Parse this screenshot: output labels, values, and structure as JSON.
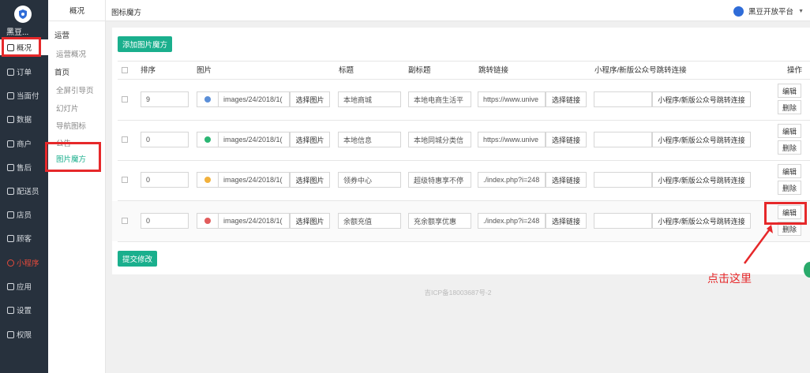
{
  "nav": {
    "brand": "黑豆...",
    "items": [
      {
        "label": "概况",
        "icon": "dashboard-icon"
      },
      {
        "label": "订单",
        "icon": "order-icon"
      },
      {
        "label": "当面付",
        "icon": "pay-icon"
      },
      {
        "label": "数据",
        "icon": "data-icon"
      },
      {
        "label": "商户",
        "icon": "merchant-icon"
      },
      {
        "label": "售后",
        "icon": "after-sale-icon"
      },
      {
        "label": "配送员",
        "icon": "courier-icon"
      },
      {
        "label": "店员",
        "icon": "clerk-icon"
      },
      {
        "label": "顾客",
        "icon": "customer-icon"
      },
      {
        "label": "小程序",
        "icon": "miniprogram-icon"
      },
      {
        "label": "应用",
        "icon": "apps-icon"
      },
      {
        "label": "设置",
        "icon": "settings-icon"
      },
      {
        "label": "权限",
        "icon": "permission-icon"
      }
    ]
  },
  "submenu": {
    "header": "概况",
    "group1": "运营",
    "group1_items": [
      "运营概况"
    ],
    "group2": "首页",
    "group2_items": [
      "全屏引导页",
      "幻灯片",
      "导航图标",
      "公告",
      "图片魔方"
    ]
  },
  "topbar": {
    "title": "图标魔方",
    "platform": "黑豆开放平台"
  },
  "toolbar": {
    "add_label": "添加图片魔方",
    "submit_label": "提交修改"
  },
  "table": {
    "headers": [
      "排序",
      "图片",
      "标题",
      "副标题",
      "跳转链接",
      "小程序/新版公众号跳转连接",
      "操作"
    ],
    "rows": [
      {
        "sort": "9",
        "image_path": "images/24/2018/1(",
        "title": "本地商城",
        "subtitle": "本地电商生活平",
        "link": "https://www.unive",
        "mini_link": "",
        "dot_color": "#5b8fd8"
      },
      {
        "sort": "0",
        "image_path": "images/24/2018/1(",
        "title": "本地信息",
        "subtitle": "本地同城分类信",
        "link": "https://www.unive",
        "mini_link": "",
        "dot_color": "#2bb673"
      },
      {
        "sort": "0",
        "image_path": "images/24/2018/1(",
        "title": "领券中心",
        "subtitle": "超级特惠享不停",
        "link": "./index.php?i=248",
        "mini_link": "",
        "dot_color": "#f2b13c"
      },
      {
        "sort": "0",
        "image_path": "images/24/2018/1(",
        "title": "余额充值",
        "subtitle": "充余额享优惠",
        "link": "./index.php?i=248",
        "mini_link": "",
        "dot_color": "#e25c5c"
      }
    ],
    "select_image_label": "选择图片",
    "select_link_label": "选择链接",
    "mini_link_label": "小程序/新版公众号跳转连接",
    "edit_label": "编辑",
    "delete_label": "删除"
  },
  "footer": "吉ICP备18003687号-2",
  "annotation": "点击这里",
  "colors": {
    "accent": "#1aaf8d",
    "nav_bg": "#27313d",
    "highlight": "#e6282a"
  }
}
